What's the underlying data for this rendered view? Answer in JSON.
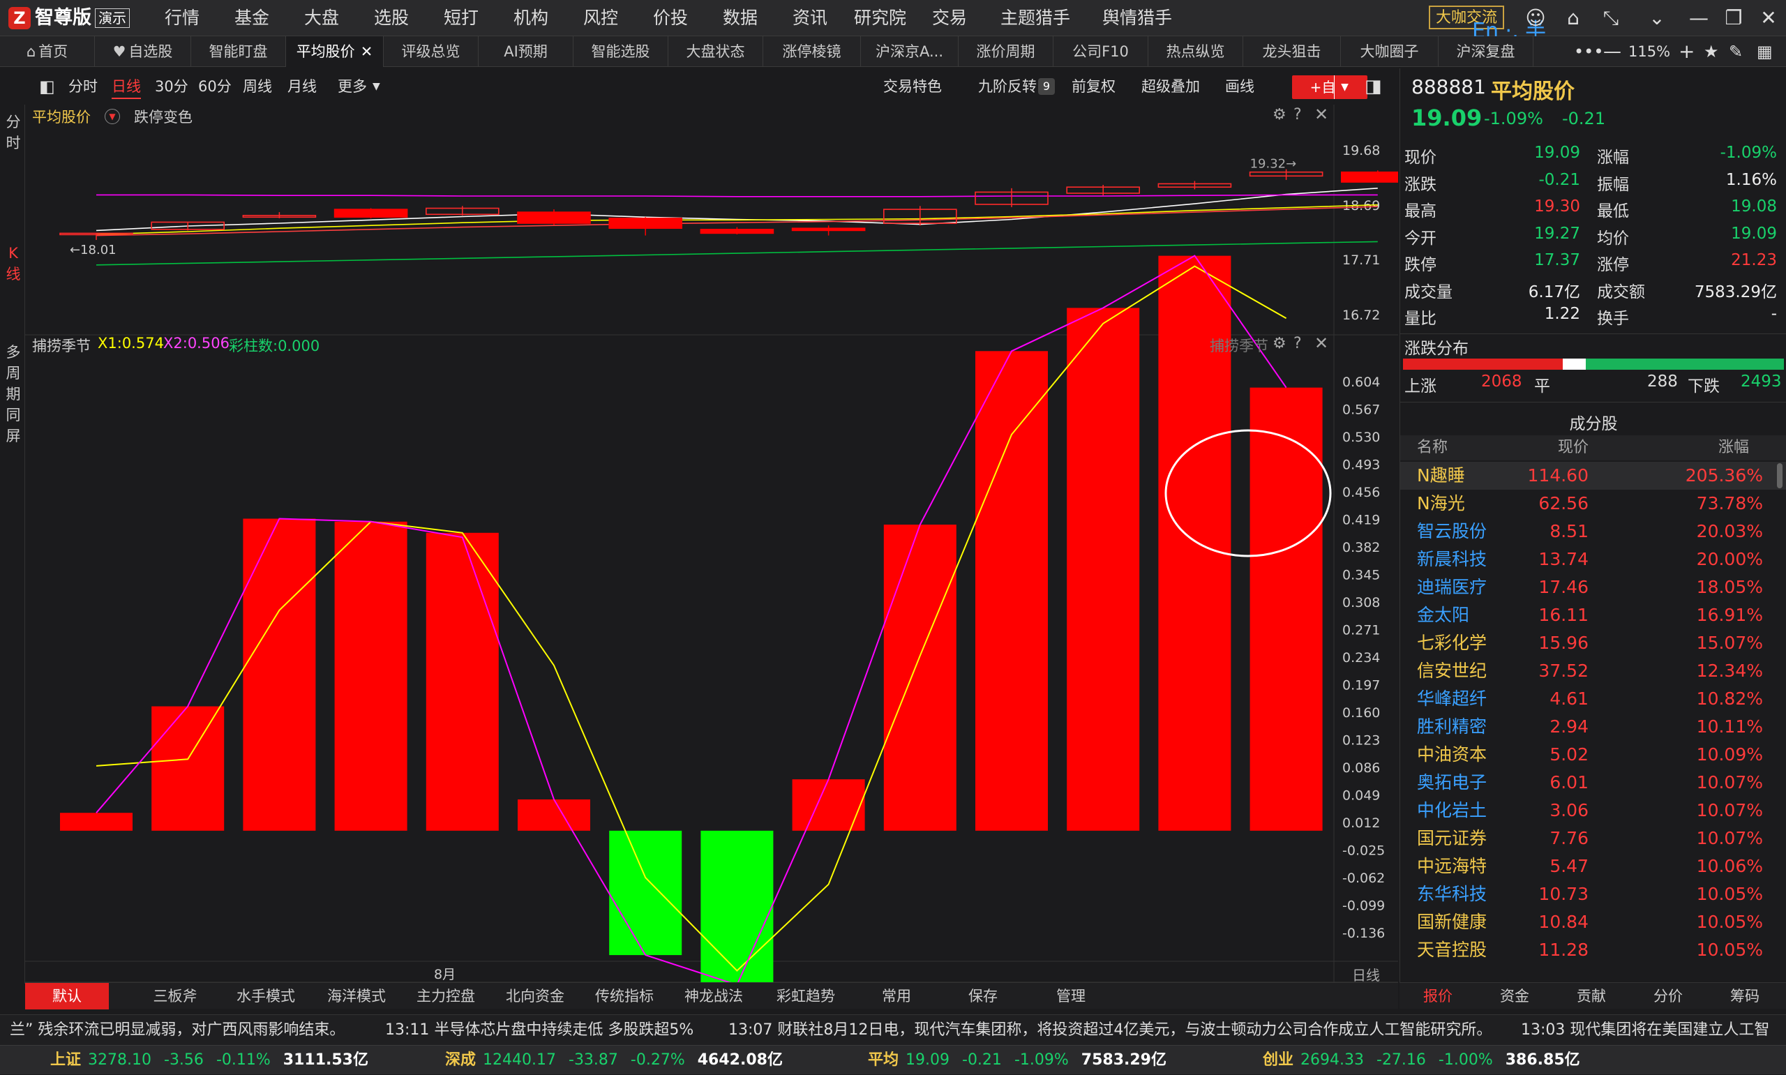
{
  "app": {
    "logo_glyph": "Z",
    "name": "智尊版",
    "badge": "演示"
  },
  "menu": [
    "行情",
    "基金",
    "大盘",
    "选股",
    "短打",
    "机构",
    "风控",
    "价投",
    "数据",
    "资讯",
    "研究院",
    "交易",
    "主题猎手",
    "舆情猎手"
  ],
  "dakashow": "大咖交流",
  "ime": "En ·, 半",
  "tabs": [
    {
      "label": "首页",
      "icon": "home-icon"
    },
    {
      "label": "自选股",
      "icon": "heart-icon"
    },
    {
      "label": "智能盯盘"
    },
    {
      "label": "平均股价",
      "active": true
    },
    {
      "label": "评级总览"
    },
    {
      "label": "AI预期"
    },
    {
      "label": "智能选股"
    },
    {
      "label": "大盘状态"
    },
    {
      "label": "涨停棱镜"
    },
    {
      "label": "沪深京A..."
    },
    {
      "label": "涨价周期"
    },
    {
      "label": "公司F10"
    },
    {
      "label": "热点纵览"
    },
    {
      "label": "龙头狙击"
    },
    {
      "label": "大咖圈子"
    },
    {
      "label": "沪深复盘"
    }
  ],
  "zoom": "115%",
  "toolbar": {
    "period": [
      "分时",
      "日线",
      "30分",
      "60分",
      "周线",
      "月线",
      "更多"
    ],
    "active_period": "日线",
    "tools": [
      "交易特色",
      "九阶反转",
      "前复权",
      "超级叠加",
      "画线"
    ],
    "nine_badge": "9",
    "add_fav": "+自选"
  },
  "left_rail": {
    "fenshi": [
      "分",
      "时"
    ],
    "kxian": [
      "K",
      "线"
    ],
    "multi": [
      "多",
      "周",
      "期",
      "同",
      "屏"
    ]
  },
  "upper_chart": {
    "title": "平均股价",
    "option": "跌停变色",
    "yticks": [
      "19.68",
      "18.69",
      "17.71",
      "16.72"
    ],
    "hi_label": "19.32→",
    "lo_label": "←18.01"
  },
  "lower_chart": {
    "title": "捕捞季节",
    "x1": "X1:0.574",
    "x2": "X2:0.506",
    "bars": "彩柱数:0.000",
    "tag": "捕捞季节",
    "yticks": [
      "0.604",
      "0.567",
      "0.530",
      "0.493",
      "0.456",
      "0.419",
      "0.382",
      "0.345",
      "0.308",
      "0.271",
      "0.234",
      "0.197",
      "0.160",
      "0.123",
      "0.086",
      "0.049",
      "0.012",
      "-0.025",
      "-0.062",
      "-0.099",
      "-0.136"
    ],
    "month_label": "8月",
    "period_label": "日线"
  },
  "chart_data": [
    {
      "type": "candlestick",
      "title": "平均股价",
      "ylim": [
        16.72,
        19.68
      ],
      "candles": [
        {
          "o": 18.17,
          "c": 18.17,
          "h": 18.17,
          "l": 18.05
        },
        {
          "o": 18.24,
          "c": 18.37,
          "h": 18.37,
          "l": 18.22
        },
        {
          "o": 18.46,
          "c": 18.49,
          "h": 18.55,
          "l": 18.44
        },
        {
          "o": 18.6,
          "c": 18.46,
          "h": 18.62,
          "l": 18.44
        },
        {
          "o": 18.51,
          "c": 18.62,
          "h": 18.66,
          "l": 18.49
        },
        {
          "o": 18.55,
          "c": 18.35,
          "h": 18.6,
          "l": 18.32
        },
        {
          "o": 18.44,
          "c": 18.26,
          "h": 18.46,
          "l": 18.13
        },
        {
          "o": 18.24,
          "c": 18.17,
          "h": 18.28,
          "l": 18.15
        },
        {
          "o": 18.26,
          "c": 18.22,
          "h": 18.31,
          "l": 18.13
        },
        {
          "o": 18.35,
          "c": 18.6,
          "h": 18.66,
          "l": 18.31
        },
        {
          "o": 18.69,
          "c": 18.91,
          "h": 18.98,
          "l": 18.64
        },
        {
          "o": 18.89,
          "c": 19.0,
          "h": 19.04,
          "l": 18.85
        },
        {
          "o": 19.0,
          "c": 19.06,
          "h": 19.11,
          "l": 18.96
        },
        {
          "o": 19.2,
          "c": 19.27,
          "h": 19.32,
          "l": 19.13
        },
        {
          "o": 19.27,
          "c": 19.09,
          "h": 19.3,
          "l": 19.08
        }
      ],
      "ma": [
        {
          "color": "#ffffff",
          "values": [
            18.22,
            18.3,
            18.35,
            18.41,
            18.47,
            18.52,
            18.46,
            18.42,
            18.39,
            18.33,
            18.42,
            18.55,
            18.7,
            18.87,
            18.98
          ]
        },
        {
          "color": "#ffff00",
          "values": [
            18.15,
            18.2,
            18.26,
            18.31,
            18.36,
            18.4,
            18.41,
            18.41,
            18.42,
            18.43,
            18.47,
            18.52,
            18.58,
            18.63,
            18.68
          ]
        },
        {
          "color": "#ff00ff",
          "values": [
            18.86,
            18.86,
            18.85,
            18.85,
            18.84,
            18.84,
            18.84,
            18.83,
            18.83,
            18.83,
            18.84,
            18.84,
            18.85,
            18.86,
            18.86
          ]
        },
        {
          "color": "#00c040",
          "values": [
            17.6,
            17.63,
            17.66,
            17.69,
            17.72,
            17.75,
            17.78,
            17.81,
            17.84,
            17.87,
            17.9,
            17.93,
            17.96,
            17.99,
            18.02
          ]
        },
        {
          "color": "#ff4040",
          "values": [
            18.13,
            18.16,
            18.2,
            18.24,
            18.28,
            18.31,
            18.34,
            18.36,
            18.38,
            18.41,
            18.45,
            18.5,
            18.55,
            18.6,
            18.65
          ]
        }
      ]
    },
    {
      "type": "bar",
      "title": "捕捞季节",
      "ylim": [
        -0.136,
        0.604
      ],
      "values": [
        0.024,
        0.167,
        0.419,
        0.415,
        0.4,
        0.042,
        -0.167,
        -0.207,
        0.069,
        0.411,
        0.644,
        0.702,
        0.772,
        0.595
      ],
      "series": [
        {
          "name": "X1",
          "color": "#ffff00",
          "values": [
            0.087,
            0.096,
            0.296,
            0.415,
            0.4,
            0.222,
            -0.063,
            -0.188,
            -0.072,
            0.235,
            0.532,
            0.681,
            0.758,
            0.688
          ]
        },
        {
          "name": "X2",
          "color": "#ff00ff",
          "values": [
            0.024,
            0.167,
            0.419,
            0.415,
            0.394,
            0.042,
            -0.167,
            -0.207,
            0.069,
            0.411,
            0.644,
            0.702,
            0.772,
            0.595
          ]
        }
      ]
    }
  ],
  "quote": {
    "code": "888881",
    "name": "平均股价",
    "price": "19.09",
    "pct": "-1.09%",
    "chg": "-0.21",
    "rows": [
      [
        {
          "l": "现价",
          "v": "19.09",
          "c": "down"
        },
        {
          "l": "涨幅",
          "v": "-1.09%",
          "c": "down"
        }
      ],
      [
        {
          "l": "涨跌",
          "v": "-0.21",
          "c": "down"
        },
        {
          "l": "振幅",
          "v": "1.16%",
          "c": "white"
        }
      ],
      [
        {
          "l": "最高",
          "v": "19.30",
          "c": "up"
        },
        {
          "l": "最低",
          "v": "19.08",
          "c": "down"
        }
      ],
      [
        {
          "l": "今开",
          "v": "19.27",
          "c": "down"
        },
        {
          "l": "均价",
          "v": "19.09",
          "c": "down"
        }
      ],
      [
        {
          "l": "跌停",
          "v": "17.37",
          "c": "down"
        },
        {
          "l": "涨停",
          "v": "21.23",
          "c": "up"
        }
      ],
      [
        {
          "l": "成交量",
          "v": "6.17亿",
          "c": "white"
        },
        {
          "l": "成交额",
          "v": "7583.29亿",
          "c": "white"
        }
      ],
      [
        {
          "l": "量比",
          "v": "1.22",
          "c": "white"
        },
        {
          "l": "换手",
          "v": "-",
          "c": "white"
        }
      ]
    ]
  },
  "breadth": {
    "title": "涨跌分布",
    "up_label": "上涨",
    "up": "2068",
    "flat_label": "平",
    "flat": "288",
    "down_label": "下跌",
    "down": "2493",
    "up_frac": 0.42,
    "flat_frac": 0.06,
    "down_frac": 0.52
  },
  "constituents": {
    "title": "成分股",
    "headers": [
      "名称",
      "现价",
      "涨幅"
    ],
    "rows": [
      {
        "name": "N趣睡",
        "price": "114.60",
        "pct": "205.36%",
        "cls": "yellow"
      },
      {
        "name": "N海光",
        "price": "62.56",
        "pct": "73.78%",
        "cls": "yellow"
      },
      {
        "name": "智云股份",
        "price": "8.51",
        "pct": "20.03%",
        "cls": "blue"
      },
      {
        "name": "新晨科技",
        "price": "13.74",
        "pct": "20.00%",
        "cls": "blue"
      },
      {
        "name": "迪瑞医疗",
        "price": "17.46",
        "pct": "18.05%",
        "cls": "blue"
      },
      {
        "name": "金太阳",
        "price": "16.11",
        "pct": "16.91%",
        "cls": "blue"
      },
      {
        "name": "七彩化学",
        "price": "15.96",
        "pct": "15.07%",
        "cls": "yellow"
      },
      {
        "name": "信安世纪",
        "price": "37.52",
        "pct": "12.34%",
        "cls": "yellow"
      },
      {
        "name": "华峰超纤",
        "price": "4.61",
        "pct": "10.82%",
        "cls": "blue"
      },
      {
        "name": "胜利精密",
        "price": "2.94",
        "pct": "10.11%",
        "cls": "blue"
      },
      {
        "name": "中油资本",
        "price": "5.02",
        "pct": "10.09%",
        "cls": "yellow"
      },
      {
        "name": "奥拓电子",
        "price": "6.01",
        "pct": "10.07%",
        "cls": "blue"
      },
      {
        "name": "中化岩土",
        "price": "3.06",
        "pct": "10.07%",
        "cls": "blue"
      },
      {
        "name": "国元证券",
        "price": "7.76",
        "pct": "10.07%",
        "cls": "yellow"
      },
      {
        "name": "中远海特",
        "price": "5.47",
        "pct": "10.06%",
        "cls": "yellow"
      },
      {
        "name": "东华科技",
        "price": "10.73",
        "pct": "10.05%",
        "cls": "blue"
      },
      {
        "name": "国新健康",
        "price": "10.84",
        "pct": "10.05%",
        "cls": "yellow"
      },
      {
        "name": "天音控股",
        "price": "11.28",
        "pct": "10.05%",
        "cls": "yellow"
      }
    ]
  },
  "bottom_tabs": [
    "默认",
    "三板斧",
    "水手模式",
    "海洋模式",
    "主力控盘",
    "北向资金",
    "传统指标",
    "神龙战法",
    "彩虹趋势",
    "常用",
    "保存",
    "管理"
  ],
  "right_tabs": [
    "报价",
    "资金",
    "贡献",
    "分价",
    "筹码"
  ],
  "news": [
    "兰” 残余环流已明显减弱，对广西风雨影响结束。",
    "13:11 半导体芯片盘中持续走低 多股跌超5%",
    "13:07 财联社8月12日电，现代汽车集团称，将投资超过4亿美元，与波士顿动力公司合作成立人工智能研究所。",
    "13:03 现代集团将在美国建立人工智"
  ],
  "indices": [
    {
      "name": "上证",
      "price": "3278.10",
      "chg": "-3.56",
      "pct": "-0.11%",
      "amt": "3111.53亿"
    },
    {
      "name": "深成",
      "price": "12440.17",
      "chg": "-33.87",
      "pct": "-0.27%",
      "amt": "4642.08亿"
    },
    {
      "name": "平均",
      "price": "19.09",
      "chg": "-0.21",
      "pct": "-1.09%",
      "amt": "7583.29亿"
    },
    {
      "name": "创业",
      "price": "2694.33",
      "chg": "-27.16",
      "pct": "-1.00%",
      "amt": "386.85亿"
    }
  ],
  "colors": {
    "up": "#ff0000",
    "down": "#00ff00",
    "yellow_name": "#f1c84b",
    "blue_name": "#3aa0ff"
  }
}
